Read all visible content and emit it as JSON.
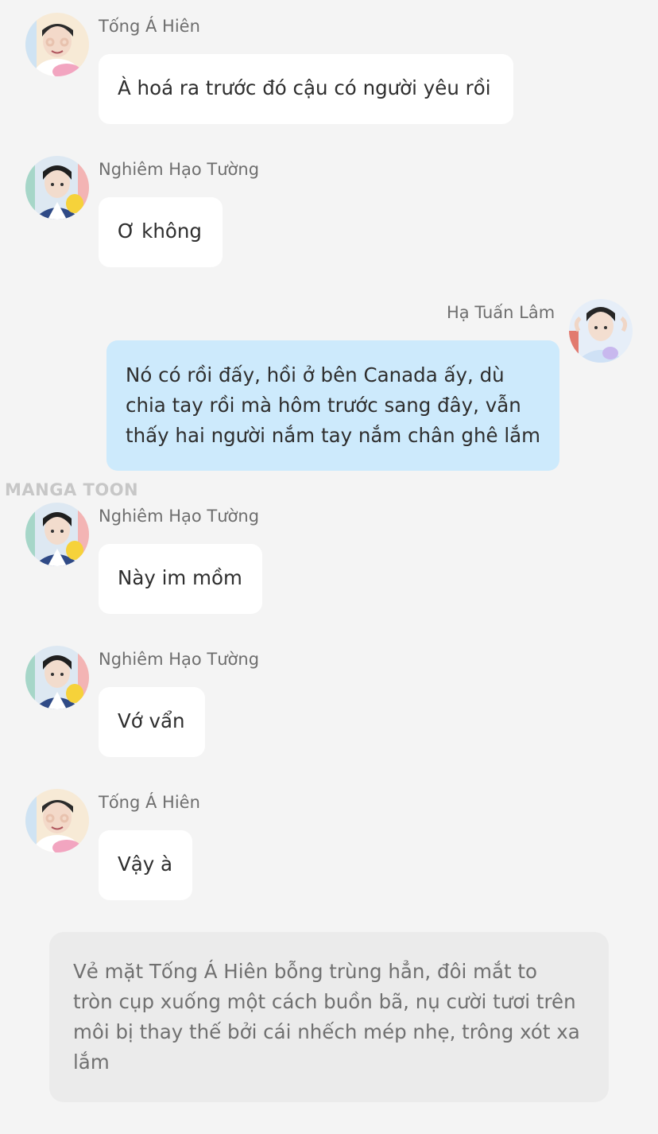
{
  "watermark": "MANGA TOON",
  "characters": {
    "tong": {
      "name": "Tống Á Hiên",
      "avatar_icon": "avatar-tong-a-hien",
      "bg": "#f7ead6",
      "accent": "#f2a5c0"
    },
    "nghiem": {
      "name": "Nghiêm Hạo Tường",
      "avatar_icon": "avatar-nghiem-hao-tuong",
      "bg": "#dde8f2",
      "accent": "#f6d23a"
    },
    "ha": {
      "name": "Hạ Tuấn Lâm",
      "avatar_icon": "avatar-ha-tuan-lam",
      "bg": "#e6eef8",
      "accent": "#c8b8ee"
    }
  },
  "messages": [
    {
      "side": "left",
      "sender": "Tống Á Hiên",
      "lines": [
        "À hoá ra trước đó cậu có người yêu rồi"
      ]
    },
    {
      "side": "left",
      "sender": "Nghiêm Hạo Tường",
      "lines": [
        "Ơ không"
      ]
    },
    {
      "side": "right",
      "sender": "Hạ Tuấn Lâm",
      "lines": [
        "Nó có rồi đấy, hồi ở bên Canada ấy, dù",
        "chia tay rồi mà hôm trước sang đây, vẫn",
        "thấy hai người nắm tay nắm chân ghê lắm"
      ]
    },
    {
      "side": "left",
      "sender": "Nghiêm Hạo Tường",
      "lines": [
        "Này im mồm"
      ]
    },
    {
      "side": "left",
      "sender": "Nghiêm Hạo Tường",
      "lines": [
        "Vớ vẩn"
      ]
    },
    {
      "side": "left",
      "sender": "Tống Á Hiên",
      "lines": [
        "Vậy à"
      ]
    }
  ],
  "narration": {
    "lines": [
      "Vẻ mặt Tống Á Hiên bỗng trùng hẳn, đôi mắt to",
      "tròn cụp xuống một cách buồn bã, nụ cười tươi trên",
      "môi bị thay thế bởi cái nhếch mép nhẹ, trông xót xa",
      "lắm"
    ]
  },
  "colors": {
    "background": "#f4f4f4",
    "bubble_left": "#ffffff",
    "bubble_right": "#cdeafc",
    "narration_bg": "#ebebeb",
    "name_text": "#6e6e6e"
  }
}
